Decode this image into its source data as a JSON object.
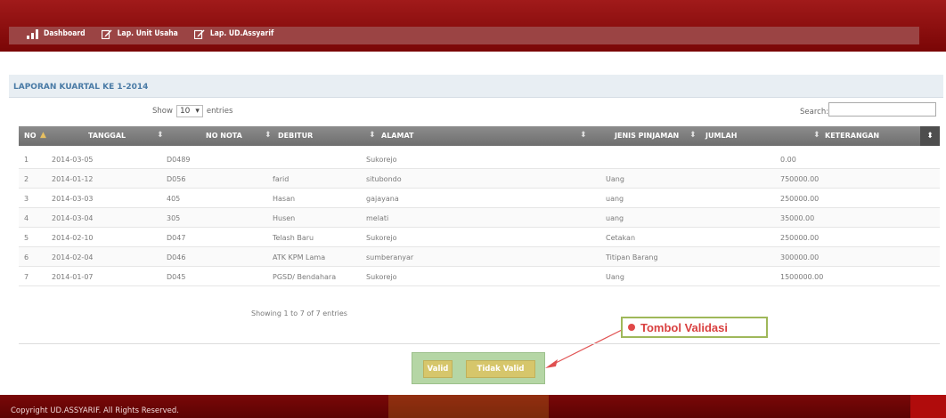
{
  "nav": {
    "items": [
      {
        "label": "Dashboard",
        "icon": "bar-chart-icon"
      },
      {
        "label": "Lap. Unit Usaha",
        "icon": "edit-icon"
      },
      {
        "label": "Lap. UD.Assyarif",
        "icon": "edit-icon"
      }
    ]
  },
  "panel": {
    "title": "LAPORAN KUARTAL KE 1-2014"
  },
  "table_controls": {
    "show_label": "Show",
    "page_size": "10",
    "entries_label": "entries",
    "search_label": "Search:",
    "search_value": ""
  },
  "table": {
    "columns": [
      "NO",
      "TANGGAL",
      "NO NOTA",
      "DEBITUR",
      "ALAMAT",
      "JENIS PINJAMAN",
      "JUMLAH",
      "KETERANGAN"
    ],
    "rows": [
      {
        "no": "1",
        "tanggal": "2014-03-05",
        "nota": "D0489",
        "debitur": "",
        "alamat": "Sukorejo",
        "jenis": "",
        "jumlah": "0.00"
      },
      {
        "no": "2",
        "tanggal": "2014-01-12",
        "nota": "D056",
        "debitur": "farid",
        "alamat": "situbondo",
        "jenis": "Uang",
        "jumlah": "750000.00"
      },
      {
        "no": "3",
        "tanggal": "2014-03-03",
        "nota": "405",
        "debitur": "Hasan",
        "alamat": "gajayana",
        "jenis": "uang",
        "jumlah": "250000.00"
      },
      {
        "no": "4",
        "tanggal": "2014-03-04",
        "nota": "305",
        "debitur": "Husen",
        "alamat": "melati",
        "jenis": "uang",
        "jumlah": "35000.00"
      },
      {
        "no": "5",
        "tanggal": "2014-02-10",
        "nota": "D047",
        "debitur": "Telash Baru",
        "alamat": "Sukorejo",
        "jenis": "Cetakan",
        "jumlah": "250000.00"
      },
      {
        "no": "6",
        "tanggal": "2014-02-04",
        "nota": "D046",
        "debitur": "ATK KPM Lama",
        "alamat": "sumberanyar",
        "jenis": "Titipan Barang",
        "jumlah": "300000.00"
      },
      {
        "no": "7",
        "tanggal": "2014-01-07",
        "nota": "D045",
        "debitur": "PGSD/ Bendahara",
        "alamat": "Sukorejo",
        "jenis": "Uang",
        "jumlah": "1500000.00"
      }
    ],
    "info": "Showing 1 to 7 of 7 entries"
  },
  "callout": {
    "text": "Tombol Validasi"
  },
  "buttons": {
    "valid": "Valid",
    "invalid": "Tidak Valid"
  },
  "footer": {
    "text": "Copyright UD.ASSYARIF. All Rights Reserved."
  },
  "colors": {
    "header": "#8b0a0a",
    "table_header": "#7a7a7a",
    "title": "#4a7ba6",
    "button": "#d6c66b",
    "callout_text": "#d94040"
  }
}
